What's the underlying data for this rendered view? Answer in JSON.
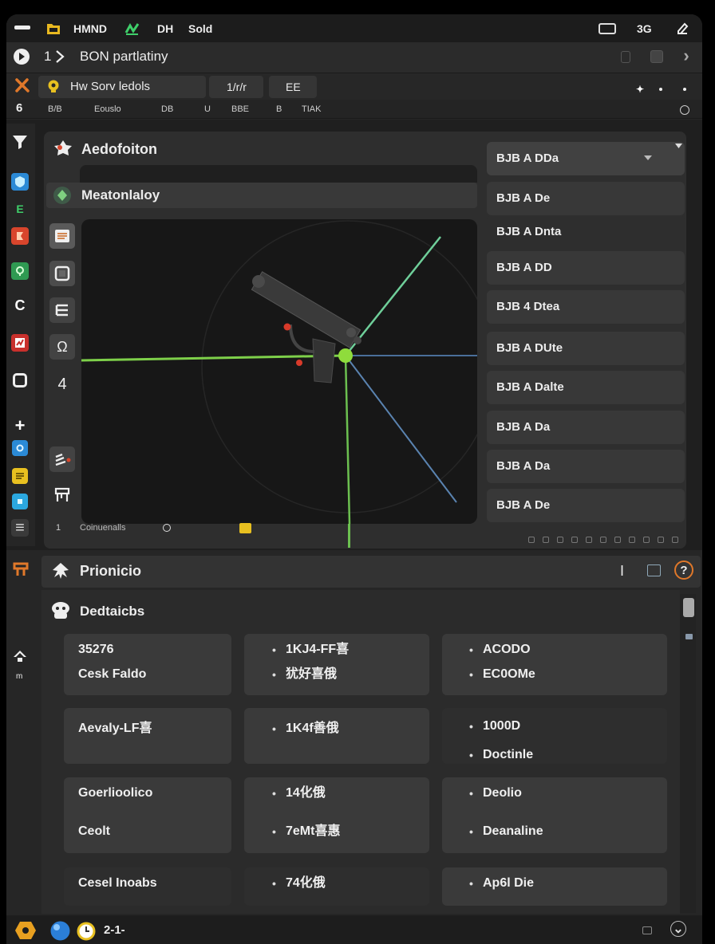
{
  "app": {
    "topbar": {
      "label1": "HMND",
      "label2": "DH",
      "label3": "Sold",
      "signal": "3G"
    },
    "breadcrumb": {
      "index": "1",
      "title": "BON partlatiny"
    },
    "toolbar": {
      "search_text": "Hw  Sorv ledols",
      "tab1": "1/r/r",
      "tab2": "EE"
    },
    "subbar": [
      "6",
      "B/B",
      "Eouslo",
      "DB",
      "U",
      "BBE",
      "B",
      "TIAK"
    ]
  },
  "panel": {
    "title": "Aedofoiton",
    "subtitle": "Meatonlaloy",
    "footer_index": "1",
    "footer_label": "Coinuenalls",
    "list": [
      "BJB A DDa",
      "BJB A De",
      "BJB A Dnta",
      "BJB A DD",
      "BJB 4 Dtea",
      "BJB A DUte",
      "BJB A Dalte",
      "BJB A Da",
      "BJB A Da",
      "BJB A De"
    ]
  },
  "details": {
    "title": "Prionicio",
    "cursor": "I",
    "section": "Dedtaicbs",
    "gutter_label": "m",
    "cards": [
      {
        "lines": [
          "35276",
          "Cesk Faldo"
        ]
      },
      {
        "lines": [
          "1KJ4-FF喜",
          "犹好喜俄"
        ]
      },
      {
        "lines": [
          "ACODO",
          "EC0OMe"
        ]
      },
      {
        "lines": [
          "Aevaly-LF喜"
        ]
      },
      {
        "lines": [
          "1K4f善俄"
        ]
      },
      {
        "lines": [
          "1000D",
          "Doctinle"
        ]
      },
      {
        "lines": [
          "Goerlioolico",
          "Ceolt"
        ]
      },
      {
        "lines": [
          "14化俄",
          "7eMt喜惠"
        ]
      },
      {
        "lines": [
          "Deolio",
          "Deanaline"
        ]
      },
      {
        "lines": [
          "Cesel Inoabs"
        ]
      },
      {
        "lines": [
          "74化俄"
        ]
      },
      {
        "lines": [
          "Ap6l Die"
        ]
      }
    ]
  },
  "statusbar": {
    "label": "2-1-"
  },
  "colors": {
    "background": "#262626",
    "panel": "#2e2e2e",
    "card": "#3a3a3a",
    "viewport": "#171717",
    "axis_green": "#7ed04a",
    "axis_blue": "#4a6f9a",
    "accent_orange": "#e0782a",
    "accent_yellow": "#e8c020",
    "accent_blue": "#2b8ad6"
  },
  "icons": [
    "menu-icon",
    "folder-icon",
    "zigzag-icon",
    "battery-icon",
    "edit-icon",
    "play-icon",
    "chevron-right-icon",
    "close-x-icon",
    "bulb-icon",
    "star-icon",
    "filter-icon",
    "shield-icon",
    "paint-icon",
    "material-icon",
    "render-icon",
    "camera-icon",
    "note-icon",
    "light-icon",
    "list-icon",
    "frame-icon",
    "lasso-icon",
    "table-icon",
    "help-icon",
    "hexagon-icon",
    "chevron-down-icon"
  ]
}
